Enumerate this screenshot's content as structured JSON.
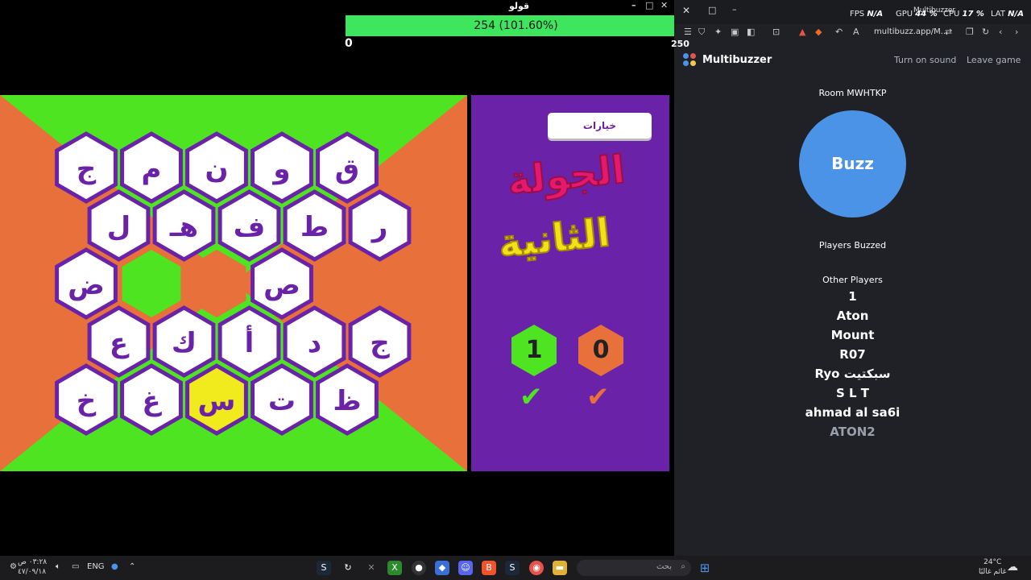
{
  "game_window": {
    "title": "قولو",
    "progress_label": "254 (101.60%)",
    "progress_value": 1.016,
    "progress_min": "0",
    "progress_max": "250",
    "controls": [
      "–",
      "□",
      "✕"
    ]
  },
  "board": {
    "rows": [
      [
        "ج",
        "م",
        "ن",
        "و",
        "ق"
      ],
      [
        "ل",
        "هـ",
        "ف",
        "ط",
        "ر"
      ],
      [
        "ض",
        "",
        "",
        "ص",
        ""
      ],
      [
        "ع",
        "ك",
        "أ",
        "د",
        "ج"
      ],
      [
        "خ",
        "غ",
        "س",
        "ت",
        "ظ"
      ]
    ],
    "colors": {
      "green": "#4fe421",
      "orange": "#e8703a",
      "yellow": "#f1ea1c",
      "purple": "#6a22a8",
      "white": "#ffffff"
    },
    "fills": [
      [
        "white",
        "white",
        "white",
        "white",
        "white"
      ],
      [
        "white",
        "white",
        "white",
        "white",
        "white"
      ],
      [
        "white",
        "green",
        "orange",
        "white",
        "orange"
      ],
      [
        "white",
        "white",
        "white",
        "white",
        "white"
      ],
      [
        "white",
        "white",
        "yellow",
        "white",
        "white"
      ]
    ]
  },
  "side_panel": {
    "options_button": "خيارات",
    "round_line1": "الجولة",
    "round_line2": "الثانية",
    "green_score": "1",
    "orange_score": "0",
    "check_mark": "✔"
  },
  "browser": {
    "tab_title": "Multibuzzer",
    "url": "multibuzz.app/M...",
    "stats": [
      {
        "label": "FPS",
        "value": "N/A"
      },
      {
        "label": "GPU",
        "value": "44 %"
      },
      {
        "label": "CPU",
        "value": "17 %"
      },
      {
        "label": "LAT",
        "value": "N/A"
      }
    ],
    "toolbar_icons": [
      "menu-icon",
      "shield-icon",
      "extension-icon",
      "wallet-icon",
      "sidebar-icon",
      "screenshot-icon",
      "brave-rewards-icon",
      "brave-shields-icon",
      "back-history-icon",
      "translate-icon",
      "tune-icon",
      "bookmark-icon",
      "reload-icon",
      "back-icon",
      "forward-icon"
    ]
  },
  "multibuzzer": {
    "brand": "Multibuzzer",
    "turn_on_sound": "Turn on sound",
    "leave_game": "Leave game",
    "room": "Room MWHTKP",
    "buzz": "Buzz",
    "players_buzzed": "Players Buzzed",
    "other_players_label": "Other Players",
    "players": [
      "1",
      "Aton",
      "Mount",
      "R07",
      "Ryo سبكتيت",
      "S L T",
      "ahmad al sa6i",
      "ATON2"
    ],
    "logo_colors": [
      "#4b93e6",
      "#e5534b",
      "#4b93e6",
      "#f2c94c"
    ]
  },
  "taskbar": {
    "clock_time": "٠٣:٢٨ ص",
    "clock_date": "٤٧/٠٩/١٨",
    "language": "ENG",
    "search_placeholder": "بحث",
    "weather_temp": "24°C",
    "weather_desc": "غائم غالبًا",
    "apps": [
      "steam-icon",
      "refresh-icon",
      "close-icon",
      "xbox-icon",
      "github-icon",
      "app-icon",
      "discord-icon",
      "brave-icon",
      "steam-icon",
      "chrome-icon",
      "folder-icon",
      "cursor-icon"
    ]
  }
}
